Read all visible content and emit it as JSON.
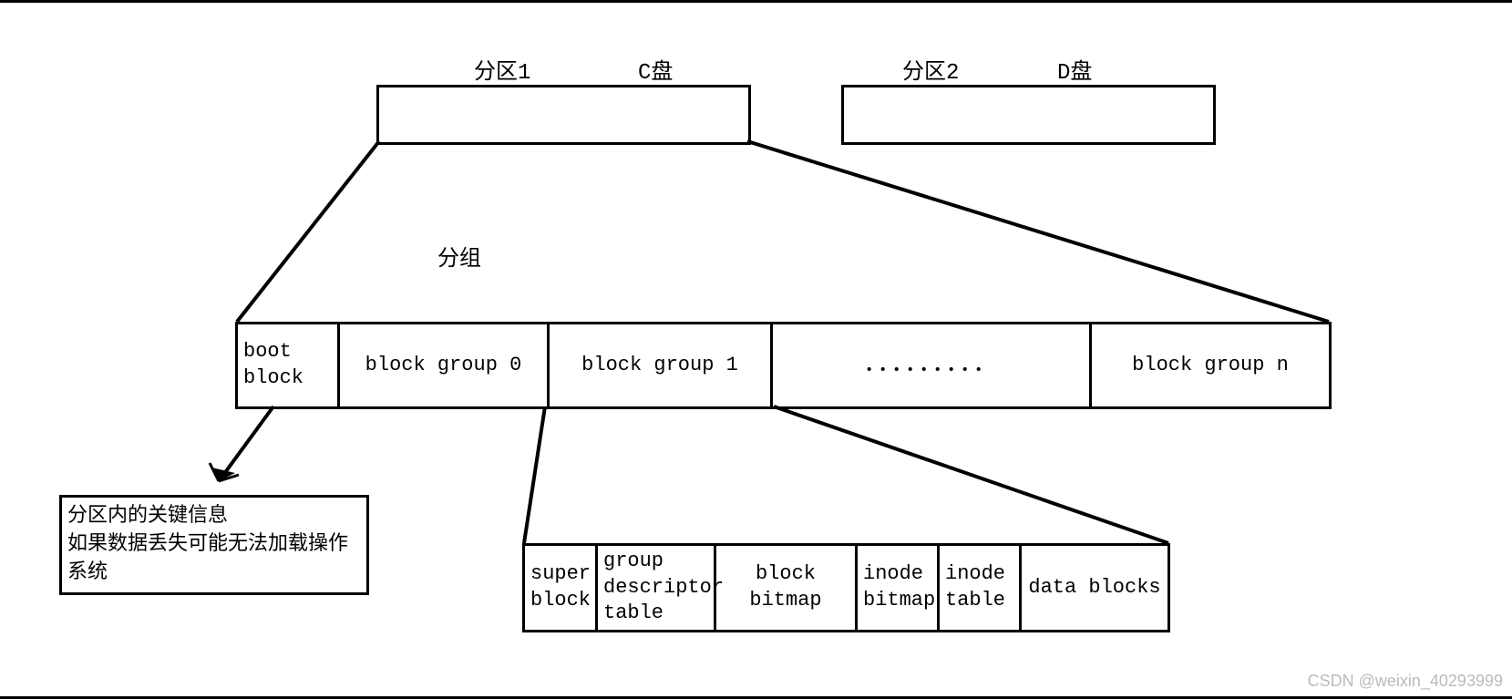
{
  "partitions": {
    "p1_label": "分区1",
    "p1_disk": "C盘",
    "p2_label": "分区2",
    "p2_disk": "D盘"
  },
  "group_label": "分组",
  "block_groups": {
    "boot": "boot\nblock",
    "g0": "block group 0",
    "g1": "block group 1",
    "dots": "．．．．．．．．．",
    "gn": "block group n"
  },
  "boot_note": {
    "line1": "分区内的关键信息",
    "line2": "如果数据丢失可能无法加载操作",
    "line3": "系统"
  },
  "group_detail": {
    "super": "super\nblock",
    "gdt": "group\ndescriptor\ntable",
    "blockbm": "block\nbitmap",
    "inodebm": "inode\nbitmap",
    "inodetbl": "inode\ntable",
    "datablk": "data blocks"
  },
  "watermark": "CSDN @weixin_40293999"
}
